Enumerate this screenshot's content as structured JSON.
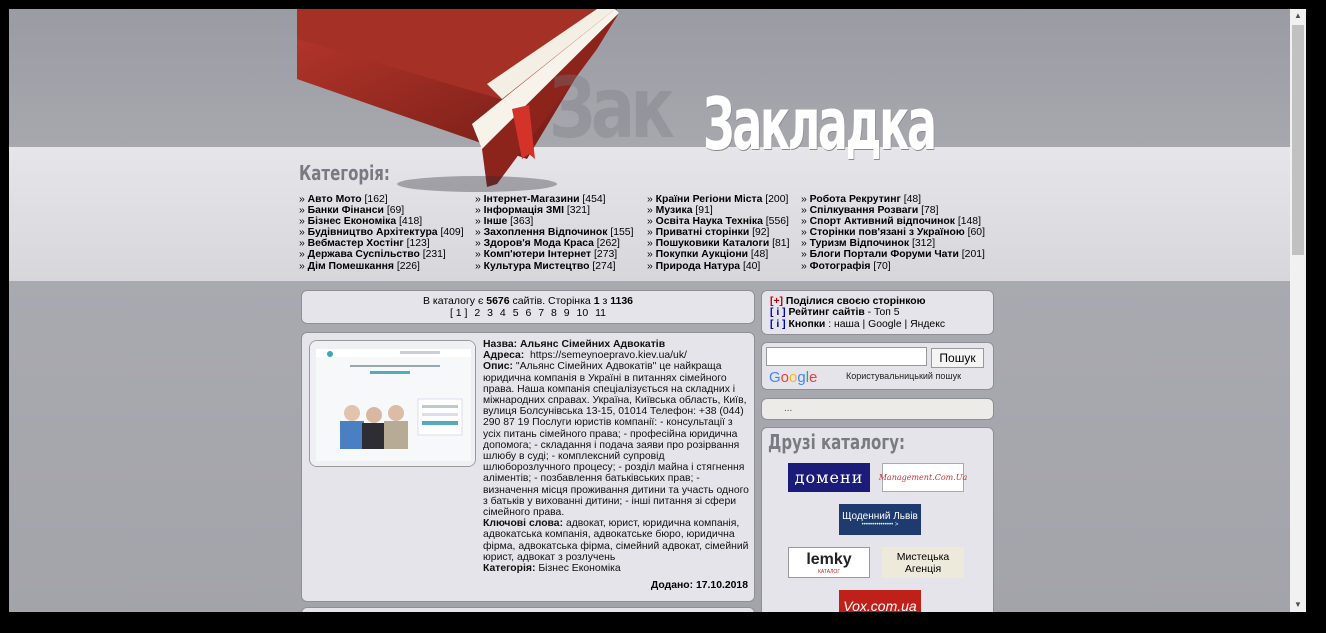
{
  "header": {
    "logo_shadow": "Зак",
    "logo": "Закладка",
    "categories_title": "Категорія:"
  },
  "categories": {
    "col1": [
      {
        "name": "Авто Мото",
        "count": "[162]"
      },
      {
        "name": "Банки Фінанси",
        "count": "[69]"
      },
      {
        "name": "Бізнес Економіка",
        "count": "[418]"
      },
      {
        "name": "Будівництво Архітектура",
        "count": "[409]"
      },
      {
        "name": "Вебмастер Хостінг",
        "count": "[123]"
      },
      {
        "name": "Держава Суспільство",
        "count": "[231]"
      },
      {
        "name": "Дім Помешкання",
        "count": "[226]"
      }
    ],
    "col2": [
      {
        "name": "Інтернет-Магазини",
        "count": "[454]"
      },
      {
        "name": "Інформація ЗМІ",
        "count": "[321]"
      },
      {
        "name": "Інше",
        "count": "[363]"
      },
      {
        "name": "Захоплення Відпочинок",
        "count": "[155]"
      },
      {
        "name": "Здоров'я Мода Краса",
        "count": "[262]"
      },
      {
        "name": "Комп'ютери Інтернет",
        "count": "[273]"
      },
      {
        "name": "Культура Мистецтво",
        "count": "[274]"
      }
    ],
    "col3": [
      {
        "name": "Країни Регіони Міста",
        "count": "[200]"
      },
      {
        "name": "Музика",
        "count": "[91]"
      },
      {
        "name": "Освіта Наука Техніка",
        "count": "[556]"
      },
      {
        "name": "Приватні сторінки",
        "count": "[92]"
      },
      {
        "name": "Пошуковики Каталоги",
        "count": "[81]"
      },
      {
        "name": "Покупки Аукціони",
        "count": "[48]"
      },
      {
        "name": "Природа Натура",
        "count": "[40]"
      }
    ],
    "col4": [
      {
        "name": "Робота Рекрутинг",
        "count": "[48]"
      },
      {
        "name": "Спілкування Розваги",
        "count": "[78]"
      },
      {
        "name": "Спорт Активний відпочинок",
        "count": "[148]"
      },
      {
        "name": "Сторінки пов'язані з Україною",
        "count": "[60]"
      },
      {
        "name": "Туризм Відпочинок",
        "count": "[312]"
      },
      {
        "name": "Блоги Портали Форуми Чати",
        "count": "[201]"
      },
      {
        "name": "Фотографія",
        "count": "[70]"
      }
    ]
  },
  "pager": {
    "prefix": "В каталогу є",
    "sites": "5676",
    "mid": "сайтів. Сторінка",
    "page": "1",
    "of": "з",
    "total": "1136",
    "current": "[ 1 ]",
    "pages": [
      "2",
      "3",
      "4",
      "5",
      "6",
      "7",
      "8",
      "9",
      "10",
      "11"
    ]
  },
  "share": {
    "plus": "[+]",
    "share_label": "Поділися своєю сторінкою",
    "i1": "[ i ]",
    "rating_label": "Рейтинг сайтів",
    "top": " - Топ 5",
    "i2": "[ i ]",
    "buttons_label": "Кнопки",
    "sep1": " : ",
    "ours": "наша",
    "bar1": " | ",
    "google": "Google",
    "bar2": " | ",
    "yandex": "Яндекс"
  },
  "search": {
    "button": "Пошук",
    "caption": "Користувальницький пошук",
    "google_letters": [
      "G",
      "o",
      "o",
      "g",
      "l",
      "e"
    ]
  },
  "dots": "...",
  "friends": {
    "title": "Друзі каталогу:",
    "domains": "домени",
    "management": "Management.Com.Ua",
    "daily": "Щоденний Львів",
    "daily_sub": "••••••••••••••• >",
    "lemky": "lemky",
    "lemky_sub": "КАТАЛОГ",
    "agency": "Мистецька Агенція",
    "vox": "Vox.com.ua"
  },
  "listing": {
    "name_label": "Назва:",
    "name": "Альянс Сімейних Адвокатів",
    "address_label": "Адреса:",
    "address": "https://semeynoepravo.kiev.ua/uk/",
    "desc_label": "Опис:",
    "desc": "\"Альянс Сімейних Адвокатів\" це найкраща юридична компанія в Україні в питаннях сімейного права. Наша компанія спеціалізується на складних і міжнародних справах. Україна, Київська область, Київ, вулиця Болсунівська 13-15, 01014 Телефон: +38 (044) 290 87 19 Послуги юристів компанії: - консультації з усіх питань сімейного права; - професійна юридична допомога; - складання і подача заяви про розірвання шлюбу в суді; - комплексний супровід шлюборозлучного процесу; - розділ майна і стягнення аліментів; - позбавлення батьківських прав; - визначення місця проживання дитини та участь одного з батьків у вихованні дитини; - інші питання зі сфери сімейного права.",
    "keywords_label": "Ключові слова:",
    "keywords": "адвокат, юрист, юридична компанія, адвокатська компанія, адвокатське бюро, юридична фірма, адвокатська фірма, сімейний адвокат, сімейний юрист, адвокат з розлучень",
    "category_label": "Категорія:",
    "category": "Бізнес Економіка",
    "added_label": "Додано:",
    "added": "17.10.2018",
    "thumb_title": "Закажіть адвоката"
  },
  "colors": {
    "book_red": "#9e2a22",
    "ribbon": "#d4332a",
    "domains_bg": "#1b1b7a",
    "vox_bg": "#c0201a"
  }
}
